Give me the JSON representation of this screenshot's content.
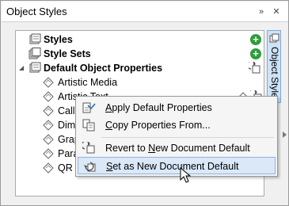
{
  "docker": {
    "title": "Object Styles",
    "collapse_icon": "double-chevron-right-icon",
    "close_icon": "close-icon"
  },
  "tree": {
    "rows": [
      {
        "label": "Styles",
        "bold": true,
        "icon": "style-icon",
        "action_icon": "add-icon"
      },
      {
        "label": "Style Sets",
        "bold": true,
        "icon": "style-set-icon",
        "action_icon": "add-icon"
      },
      {
        "label": "Default Object Properties",
        "bold": true,
        "icon": "default-properties-icon",
        "expanded": true,
        "action_icon": "revert-icon"
      },
      {
        "label": "Artistic Media",
        "bold": false,
        "icon": "sub-style-icon"
      },
      {
        "label": "Artistic Text",
        "bold": false,
        "icon": "sub-style-icon"
      },
      {
        "label": "Call",
        "bold": false,
        "icon": "sub-style-icon"
      },
      {
        "label": "Dim",
        "bold": false,
        "icon": "sub-style-icon"
      },
      {
        "label": "Grap",
        "bold": false,
        "icon": "sub-style-icon"
      },
      {
        "label": "Para",
        "bold": false,
        "icon": "sub-style-icon"
      },
      {
        "label": "QR C",
        "bold": false,
        "icon": "sub-style-icon"
      }
    ]
  },
  "vertical_tab": {
    "label": "Object Styles"
  },
  "context_menu": {
    "items": [
      {
        "label_pre": "",
        "mnemonic": "A",
        "label_post": "pply Default Properties",
        "icon": "apply-properties-icon"
      },
      {
        "label_pre": "",
        "mnemonic": "C",
        "label_post": "opy Properties From...",
        "icon": "copy-properties-icon"
      },
      {
        "label_pre": "Revert to ",
        "mnemonic": "N",
        "label_post": "ew Document Default",
        "icon": "revert-icon"
      },
      {
        "label_pre": "",
        "mnemonic": "S",
        "label_post": "et as New Document Default",
        "icon": "set-default-icon",
        "selected": true
      }
    ]
  },
  "colors": {
    "accent_add": "#2e9d3a",
    "selection_bg": "#dae8f8",
    "selection_border": "#8fb3e0",
    "tab_bg": "#cfe3f7"
  }
}
